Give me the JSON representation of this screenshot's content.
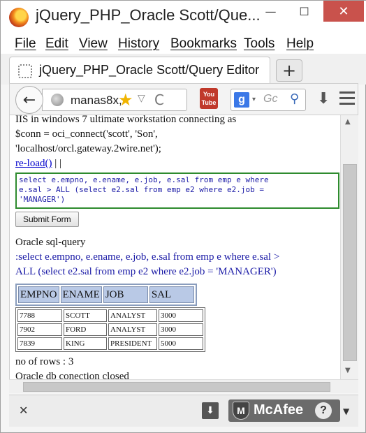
{
  "window": {
    "title": "jQuery_PHP_Oracle Scott/Que...",
    "min_glyph": "—",
    "max_glyph": "☐",
    "close_glyph": "✕"
  },
  "menu": {
    "items": [
      "File",
      "Edit",
      "View",
      "History",
      "Bookmarks",
      "Tools",
      "Help"
    ]
  },
  "tab": {
    "title": "jQuery_PHP_Oracle Scott/Query Editor",
    "new_tab_glyph": "+"
  },
  "nav": {
    "back_glyph": "←",
    "url": "manas8x,",
    "star_glyph": "★",
    "dropdown_glyph": "▽",
    "reload_glyph": "C",
    "youtube_label": "You Tube",
    "search_engine_glyph": "g",
    "search_dropdown_glyph": "▾",
    "search_placeholder": "Gc",
    "search_glyph": "⚲",
    "download_glyph": "⬇"
  },
  "content": {
    "line1": "IIS in windows 7 ultimate workstation connecting as",
    "line2": "$conn = oci_connect('scott', 'Son',",
    "line3": "'localhost/orcl.gateway.2wire.net');",
    "reload_link": "re-load()",
    "separator": "| |",
    "sql_input": "select e.empno, e.ename, e.job, e.sal from emp e where\ne.sal > ALL (select e2.sal from emp e2 where e2.job =\n'MANAGER')",
    "submit_label": "Submit Form",
    "sql_heading": "Oracle sql-query",
    "query_line1": ":select e.empno, e.ename, e.job, e.sal from emp e where e.sal >",
    "query_line2": "ALL (select e2.sal from emp e2 where e2.job = 'MANAGER')",
    "headers": [
      "EMPNO",
      "ENAME",
      "JOB",
      "SAL"
    ],
    "rows": [
      [
        "7788",
        "SCOTT",
        "ANALYST",
        "3000"
      ],
      [
        "7902",
        "FORD",
        "ANALYST",
        "3000"
      ],
      [
        "7839",
        "KING",
        "PRESIDENT",
        "5000"
      ]
    ],
    "row_count": "no of rows : 3",
    "closed_msg": "Oracle db conection closed"
  },
  "addon": {
    "close_glyph": "✕",
    "download_glyph": "⬇",
    "mcafee_label": "McAfee",
    "mcafee_shield": "M",
    "help_glyph": "?",
    "dropdown_glyph": "▼"
  }
}
